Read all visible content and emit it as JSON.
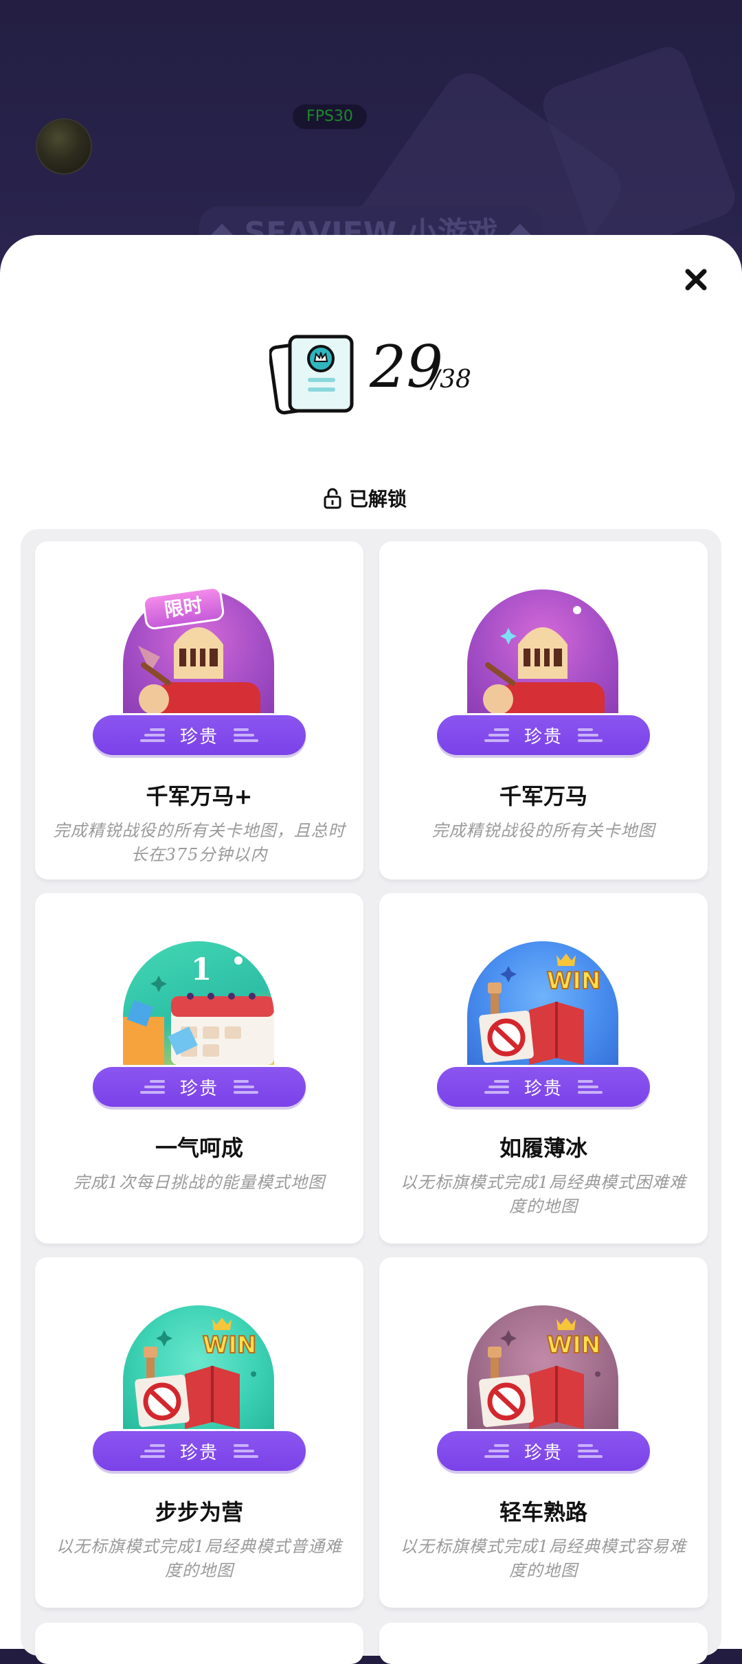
{
  "background": {
    "fps_label": "FPS30",
    "title": "◆ SEAVIEW 小游戏 ◆"
  },
  "counter": {
    "unlocked_count": "29",
    "total": "/38"
  },
  "section": {
    "unlocked_label": "已解锁"
  },
  "achievements": [
    {
      "title": "千军万马+",
      "description": "完成精锐战役的所有关卡地图，且总时长在375分钟以内",
      "rarity": "珍贵",
      "badge_tag": "限时",
      "badge_icon": "knight-helmet-icon"
    },
    {
      "title": "千军万马",
      "description": "完成精锐战役的所有关卡地图",
      "rarity": "珍贵",
      "badge_icon": "knight-helmet-icon"
    },
    {
      "title": "一气呵成",
      "description": "完成1次每日挑战的能量模式地图",
      "rarity": "珍贵",
      "badge_number": "1",
      "badge_icon": "calendar-icon"
    },
    {
      "title": "如履薄冰",
      "description": "以无标旗模式完成1局经典模式困难难度的地图",
      "rarity": "珍贵",
      "badge_win": "WIN",
      "badge_icon": "no-flag-map-icon"
    },
    {
      "title": "步步为营",
      "description": "以无标旗模式完成1局经典模式普通难度的地图",
      "rarity": "珍贵",
      "badge_win": "WIN",
      "badge_icon": "no-flag-map-icon"
    },
    {
      "title": "轻车熟路",
      "description": "以无标旗模式完成1局经典模式容易难度的地图",
      "rarity": "珍贵",
      "badge_win": "WIN",
      "badge_icon": "no-flag-map-icon"
    }
  ],
  "colors": {
    "rarity_purple": "#7b42e8",
    "badge_purple": "#a954d6",
    "badge_teal": "#3fd3b6",
    "badge_blue": "#3f88ee",
    "badge_mauve": "#a3708e"
  }
}
